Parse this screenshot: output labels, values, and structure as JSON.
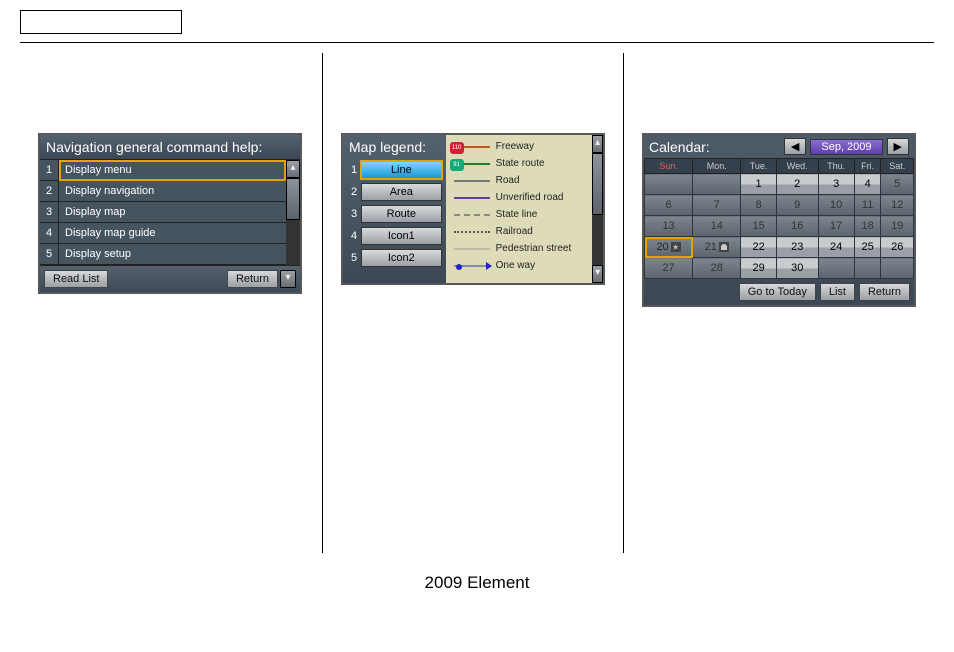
{
  "footer": "2009  Element",
  "nav": {
    "title": "Navigation general command help:",
    "items": [
      {
        "idx": "1",
        "label": "Display menu"
      },
      {
        "idx": "2",
        "label": "Display navigation"
      },
      {
        "idx": "3",
        "label": "Display map"
      },
      {
        "idx": "4",
        "label": "Display map guide"
      },
      {
        "idx": "5",
        "label": "Display setup"
      }
    ],
    "read_list": "Read List",
    "return": "Return"
  },
  "legend": {
    "title": "Map legend:",
    "buttons": [
      {
        "idx": "1",
        "label": "Line"
      },
      {
        "idx": "2",
        "label": "Area"
      },
      {
        "idx": "3",
        "label": "Route"
      },
      {
        "idx": "4",
        "label": "Icon1"
      },
      {
        "idx": "5",
        "label": "Icon2"
      }
    ],
    "items": [
      {
        "label": "Freeway",
        "shield": "110"
      },
      {
        "label": "State route",
        "shield": "91"
      },
      {
        "label": "Road"
      },
      {
        "label": "Unverified road"
      },
      {
        "label": "State line"
      },
      {
        "label": "Railroad"
      },
      {
        "label": "Pedestrian street"
      },
      {
        "label": "One way"
      }
    ]
  },
  "calendar": {
    "title": "Calendar:",
    "month": "Sep, 2009",
    "prev": "◀",
    "next": "▶",
    "dow": [
      "Sun.",
      "Mon.",
      "Tue.",
      "Wed.",
      "Thu.",
      "Fri.",
      "Sat."
    ],
    "weeks": [
      [
        "",
        "",
        "1",
        "2",
        "3",
        "4",
        "5"
      ],
      [
        "6",
        "7",
        "8",
        "9",
        "10",
        "11",
        "12"
      ],
      [
        "13",
        "14",
        "15",
        "16",
        "17",
        "18",
        "19"
      ],
      [
        "20",
        "21",
        "22",
        "23",
        "24",
        "25",
        "26"
      ],
      [
        "27",
        "28",
        "29",
        "30",
        "",
        "",
        ""
      ]
    ],
    "selected": "20",
    "markers": {
      "20": "star",
      "21": "person"
    },
    "go_today": "Go to Today",
    "list": "List",
    "return": "Return"
  }
}
